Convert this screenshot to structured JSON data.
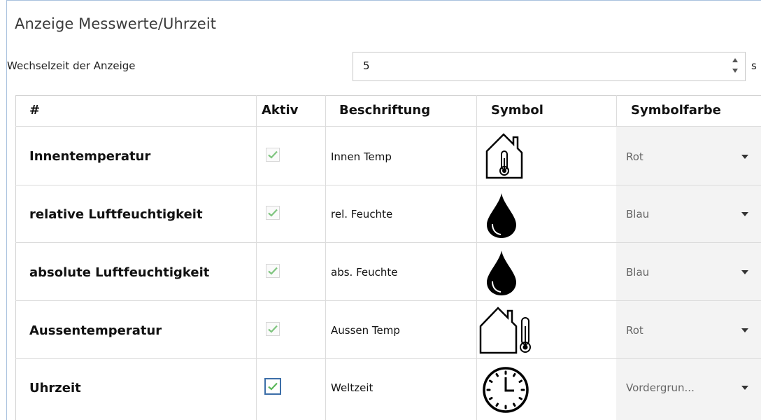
{
  "section": {
    "title": "Anzeige Messwerte/Uhrzeit"
  },
  "interval": {
    "label": "Wechselzeit der Anzeige",
    "value": "5",
    "unit": "s"
  },
  "table": {
    "headers": {
      "index": "#",
      "active": "Aktiv",
      "caption": "Beschriftung",
      "symbol": "Symbol",
      "symbol_color": "Symbolfarbe"
    },
    "rows": [
      {
        "name": "Innentemperatur",
        "active": true,
        "caption": "Innen Temp",
        "symbol": "house-thermometer-icon",
        "color": "Rot"
      },
      {
        "name": "relative Luftfeuchtigkeit",
        "active": true,
        "caption": "rel. Feuchte",
        "symbol": "water-drop-icon",
        "color": "Blau"
      },
      {
        "name": "absolute Luftfeuchtigkeit",
        "active": true,
        "caption": "abs. Feuchte",
        "symbol": "water-drop-icon",
        "color": "Blau"
      },
      {
        "name": "Aussentemperatur",
        "active": true,
        "caption": "Aussen Temp",
        "symbol": "outdoor-thermometer-icon",
        "color": "Rot"
      },
      {
        "name": "Uhrzeit",
        "active": true,
        "caption": "Weltzeit",
        "symbol": "clock-icon",
        "color": "Vordergrun..."
      }
    ]
  },
  "colors": {
    "check": "#5cb85c",
    "focus_border": "#3c6ea8",
    "frame": "#a9c1de"
  }
}
